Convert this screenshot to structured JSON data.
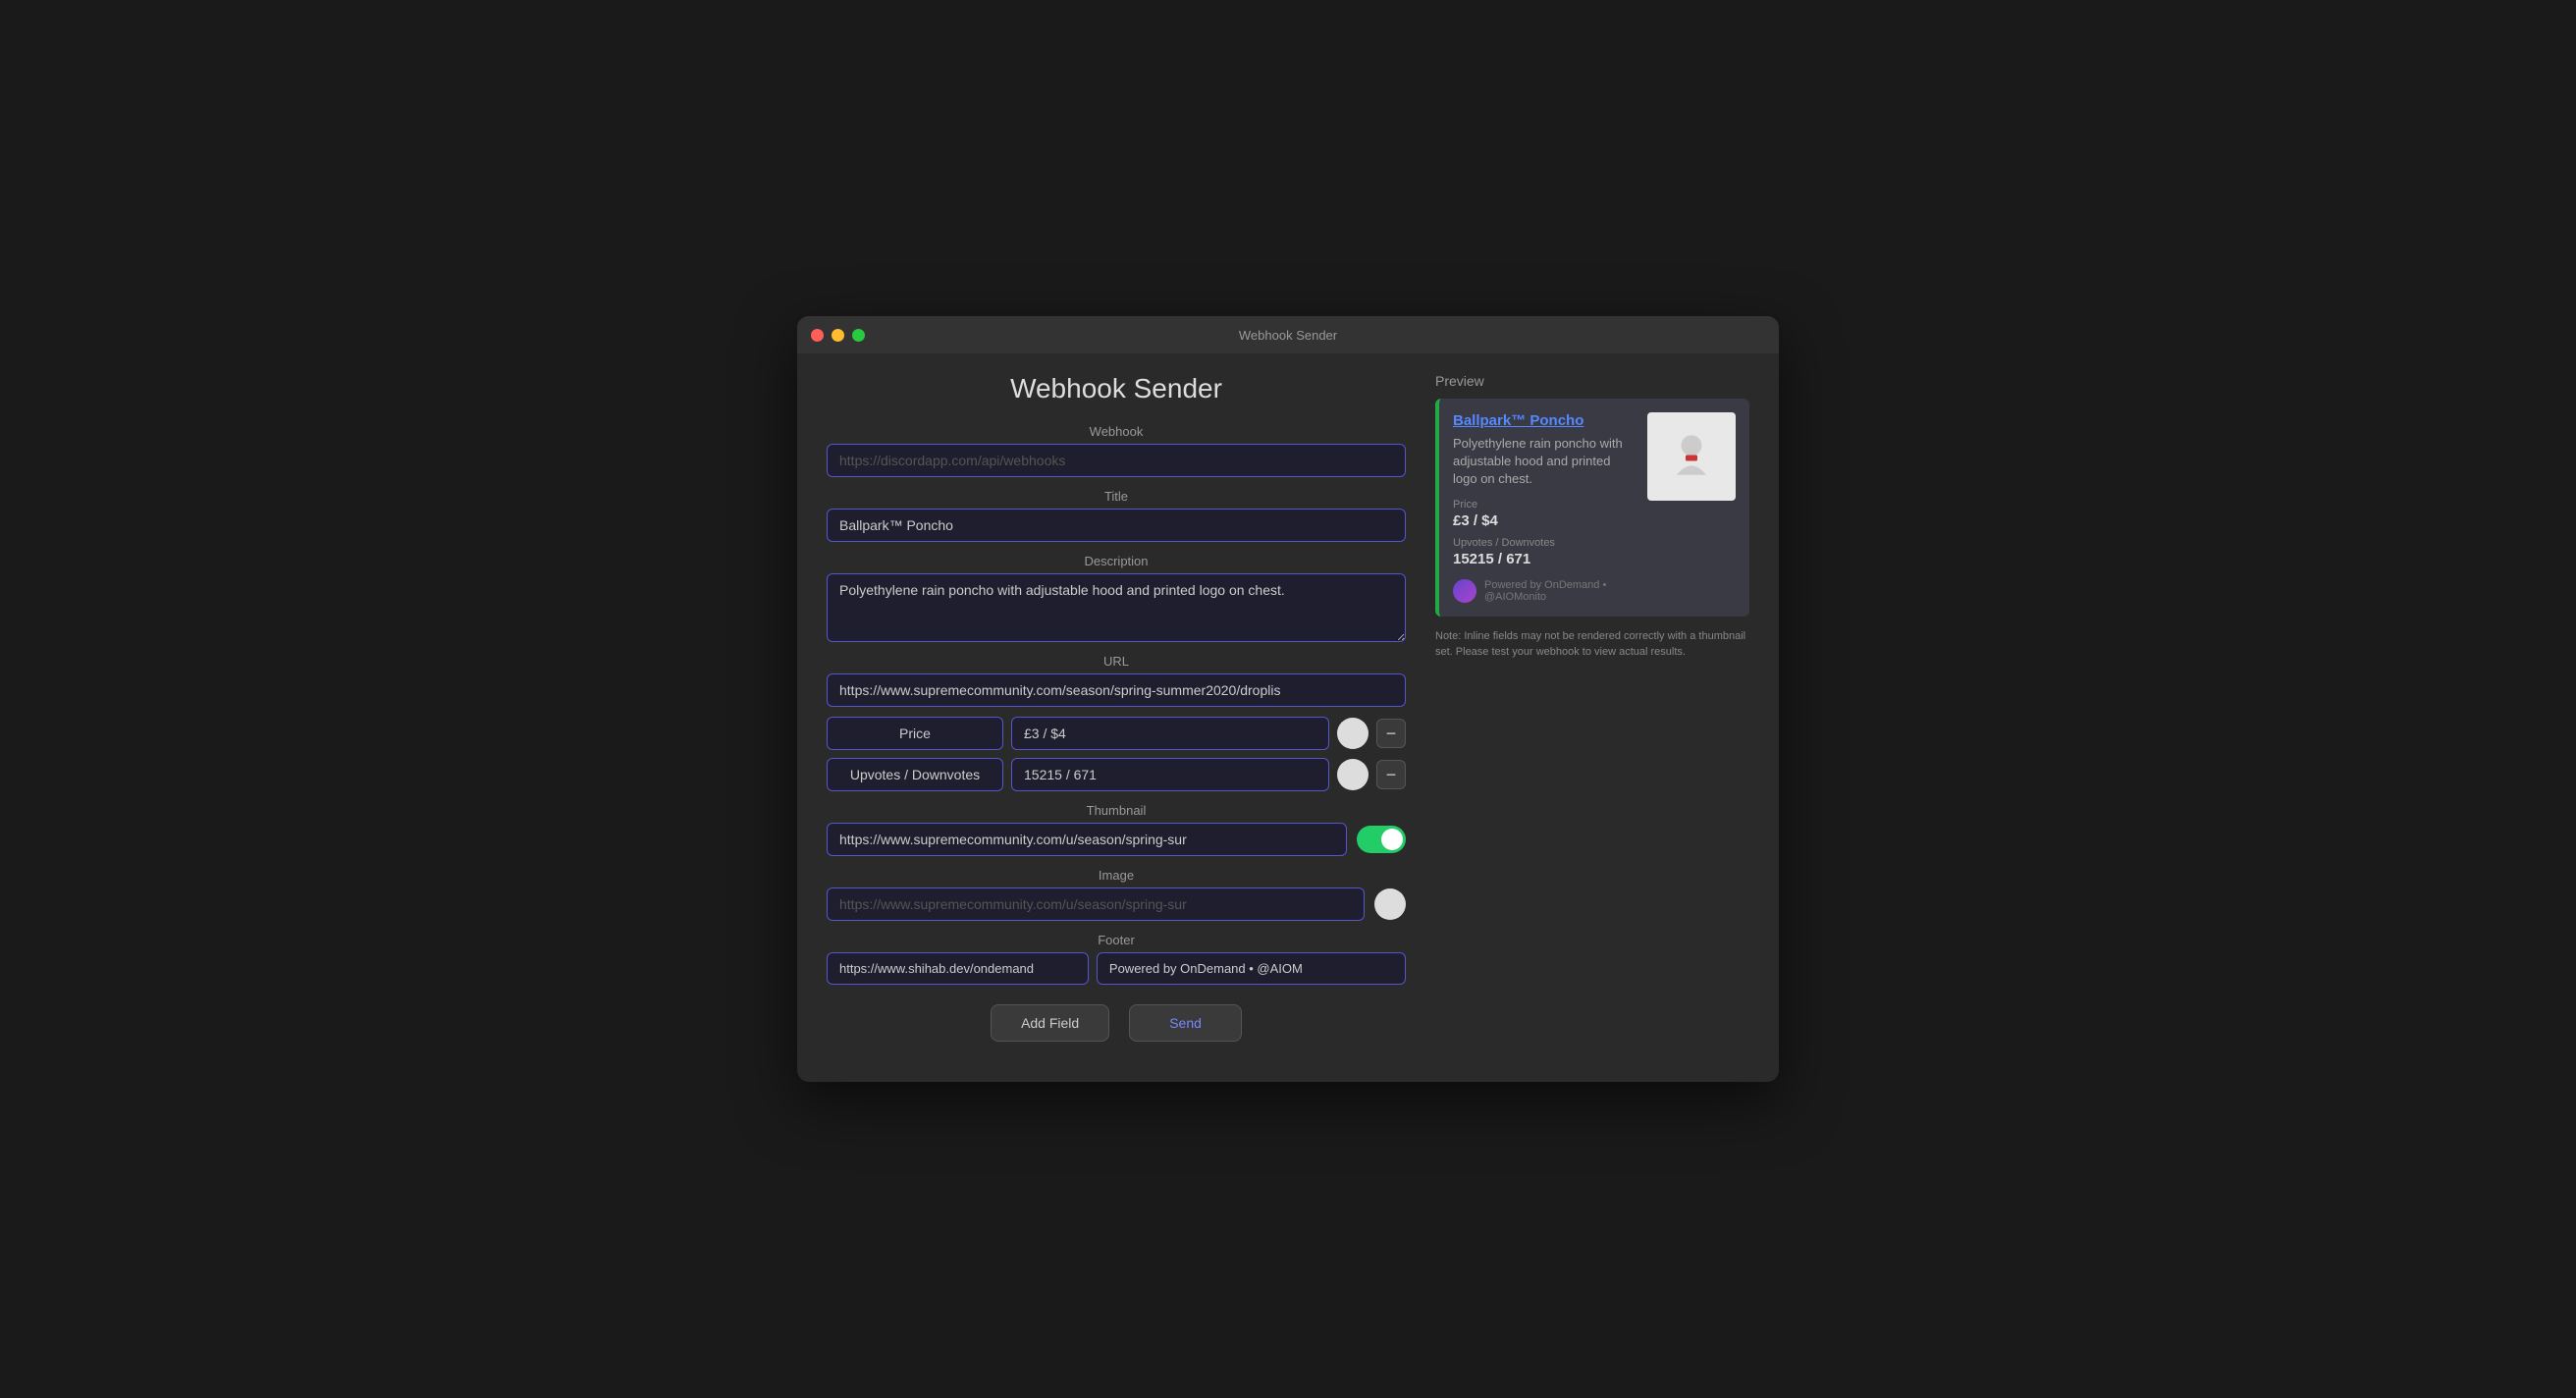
{
  "window": {
    "title": "Webhook Sender"
  },
  "page": {
    "heading": "Webhook Sender"
  },
  "form": {
    "webhook_label": "Webhook",
    "webhook_placeholder": "https://discordapp.com/api/webhooks",
    "title_label": "Title",
    "title_value": "Ballpark™ Poncho",
    "description_label": "Description",
    "description_value": "Polyethylene rain poncho with adjustable hood and printed logo on chest.",
    "url_label": "URL",
    "url_value": "https://www.supremecommunity.com/season/spring-summer2020/droplis",
    "price_label": "Price",
    "price_value": "£3 / $4",
    "upvotes_label": "Upvotes / Downvotes",
    "upvotes_value": "15215 / 671",
    "thumbnail_label": "Thumbnail",
    "thumbnail_value": "https://www.supremecommunity.com/u/season/spring-sur",
    "image_label": "Image",
    "image_placeholder": "https://www.supremecommunity.com/u/season/spring-sur",
    "footer_label": "Footer",
    "footer_url_value": "https://www.shihab.dev/ondemand",
    "footer_text_value": "Powered by OnDemand • @AIOM",
    "add_field_label": "Add Field",
    "send_label": "Send"
  },
  "preview": {
    "label": "Preview",
    "title": "Ballpark™ Poncho",
    "description": "Polyethylene rain poncho with adjustable hood and printed logo on chest.",
    "price_field_name": "Price",
    "price_field_value": "£3 / $4",
    "upvotes_field_name": "Upvotes / Downvotes",
    "upvotes_field_value": "15215 / 671",
    "footer_text": "Powered by OnDemand • @AIOMonito",
    "note": "Note: Inline fields may not be rendered correctly with a thumbnail set. Please test your webhook to view actual results."
  }
}
